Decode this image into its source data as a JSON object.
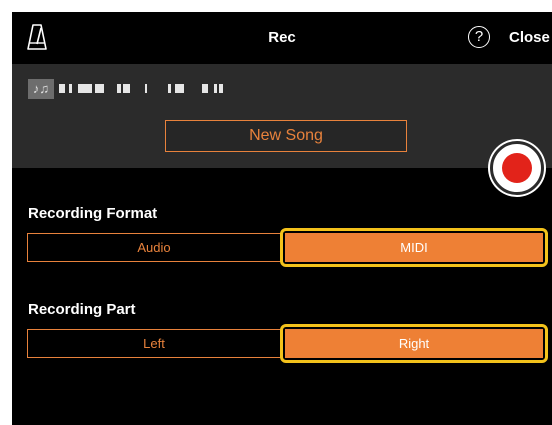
{
  "header": {
    "title": "Rec",
    "close_label": "Close",
    "help_glyph": "?",
    "left_icon": "metronome-icon"
  },
  "song": {
    "icon": "music-notes-icon",
    "icon_glyph": "♪♫",
    "new_song_label": "New Song",
    "record_icon": "record-icon"
  },
  "recording_format": {
    "label": "Recording Format",
    "options": [
      "Audio",
      "MIDI"
    ],
    "selected": "MIDI"
  },
  "recording_part": {
    "label": "Recording Part",
    "options": [
      "Left",
      "Right"
    ],
    "selected": "Right"
  },
  "colors": {
    "accent": "#e8823c",
    "selected_fill": "#ee8035",
    "highlight_outline": "#f3c21b",
    "record_red": "#e2231a"
  }
}
